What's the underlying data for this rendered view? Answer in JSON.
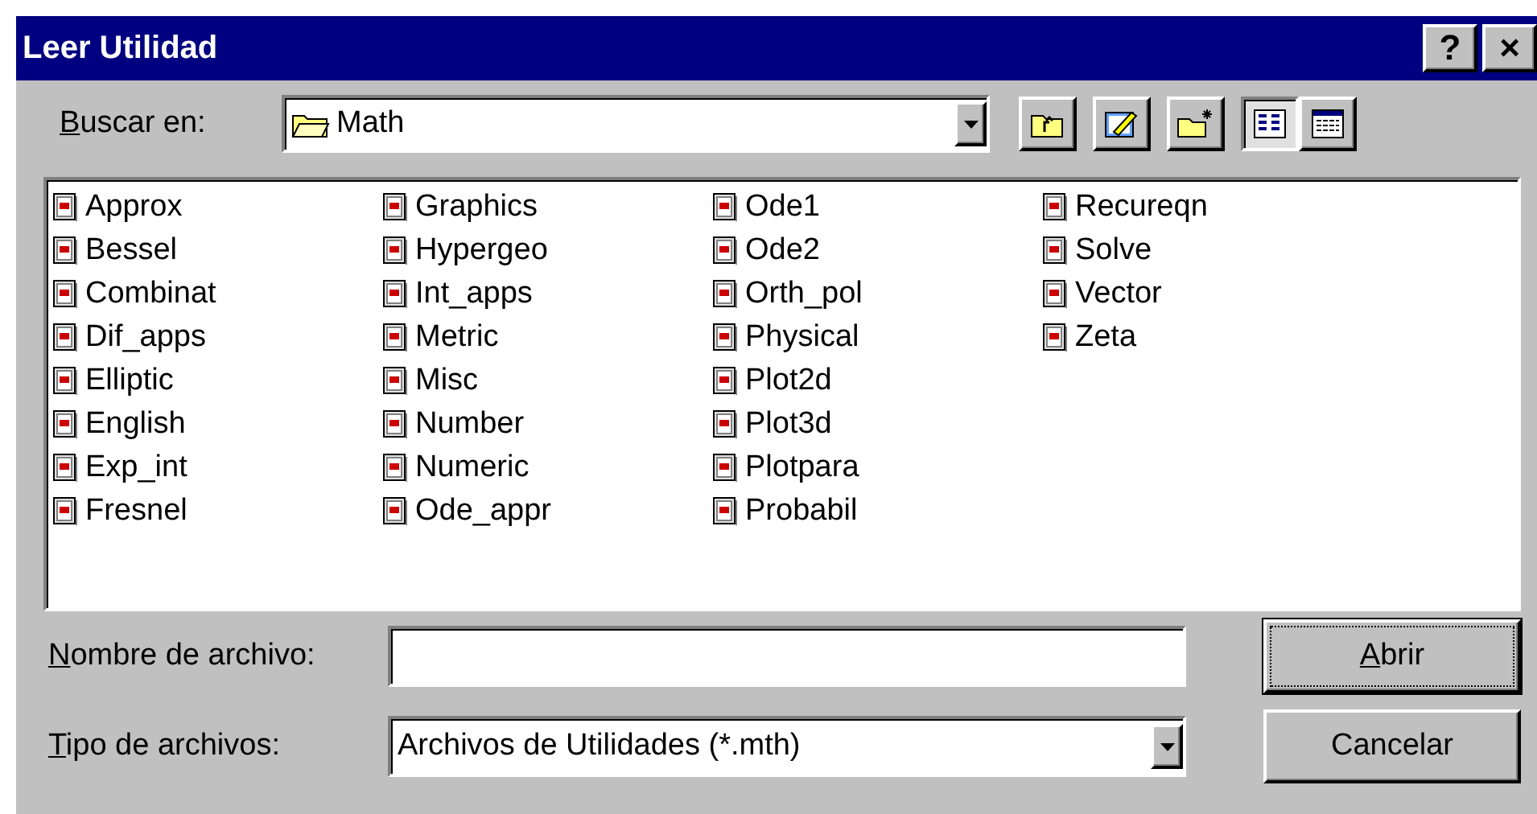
{
  "window": {
    "title": "Leer Utilidad",
    "controls": [
      "?",
      "×"
    ]
  },
  "look_in": {
    "label": "Buscar en:",
    "mnemonic": true,
    "value": "Math"
  },
  "toolbar": [
    {
      "kind": "up"
    },
    {
      "kind": "desktop"
    },
    {
      "kind": "new-folder"
    },
    {
      "kind": "list",
      "selected": true
    },
    {
      "kind": "details",
      "selected": false
    }
  ],
  "files": [
    {
      "name": "Approx"
    },
    {
      "name": "Bessel"
    },
    {
      "name": "Combinat"
    },
    {
      "name": "Dif_apps"
    },
    {
      "name": "Elliptic"
    },
    {
      "name": "English"
    },
    {
      "name": "Exp_int"
    },
    {
      "name": "Fresnel"
    },
    {
      "name": "Graphics"
    },
    {
      "name": "Hypergeo"
    },
    {
      "name": "Int_apps"
    },
    {
      "name": "Metric"
    },
    {
      "name": "Misc"
    },
    {
      "name": "Number"
    },
    {
      "name": "Numeric"
    },
    {
      "name": "Ode_appr"
    },
    {
      "name": "Ode1"
    },
    {
      "name": "Ode2"
    },
    {
      "name": "Orth_pol"
    },
    {
      "name": "Physical"
    },
    {
      "name": "Plot2d"
    },
    {
      "name": "Plot3d"
    },
    {
      "name": "Plotpara"
    },
    {
      "name": "Probabil"
    },
    {
      "name": "Recureqn"
    },
    {
      "name": "Solve"
    },
    {
      "name": "Vector"
    },
    {
      "name": "Zeta"
    }
  ],
  "file_name": {
    "label": "Nombre de archivo:",
    "mnemonic": true
  },
  "file_type": {
    "label": "Tipo de archivos:",
    "mnemonic": true,
    "value": "Archivos de Utilidades (*.mth)"
  },
  "buttons": [
    {
      "label": "Abrir",
      "mnemonic": true,
      "default": true
    },
    {
      "label": "Cancelar",
      "mnemonic": false,
      "default": false
    }
  ]
}
